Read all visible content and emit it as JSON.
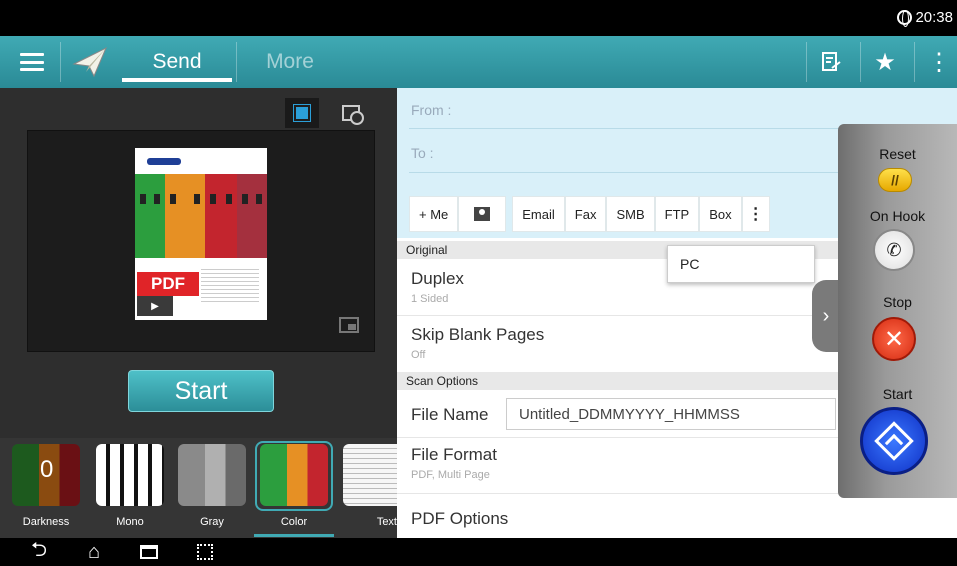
{
  "status_bar": {
    "time": "20:38",
    "icons": [
      "globe-icon"
    ]
  },
  "action_bar": {
    "menu_icon": "hamburger-icon",
    "app_icon": "paper-plane-icon",
    "tabs": [
      {
        "label": "Send",
        "selected": true
      },
      {
        "label": "More",
        "selected": false
      }
    ],
    "right_icons": [
      "edit-document-icon",
      "star-icon",
      "overflow-menu-icon"
    ]
  },
  "preview": {
    "view_modes": [
      "preview-image-icon",
      "preview-settings-icon"
    ],
    "pdf_badge": "PDF",
    "start_label": "Start"
  },
  "color_modes": [
    {
      "label": "Darkness",
      "value": "0"
    },
    {
      "label": "Mono"
    },
    {
      "label": "Gray"
    },
    {
      "label": "Color",
      "selected": true
    },
    {
      "label": "Text"
    }
  ],
  "address": {
    "from_label": "From :",
    "to_label": "To :"
  },
  "destination_buttons": [
    "+ Me",
    "Email",
    "Fax",
    "SMB",
    "FTP",
    "Box"
  ],
  "more_popup": {
    "option": "PC"
  },
  "sections": {
    "original": "Original",
    "scan_options": "Scan Options"
  },
  "settings": {
    "duplex": {
      "title": "Duplex",
      "value": "1 Sided"
    },
    "skip_blank": {
      "title": "Skip Blank Pages",
      "value": "Off"
    },
    "file_name": {
      "title": "File Name",
      "value": "Untitled_DDMMYYYY_HHMMSS"
    },
    "file_format": {
      "title": "File Format",
      "value": "PDF, Multi Page"
    },
    "pdf_options": {
      "title": "PDF Options"
    }
  },
  "control_panel": {
    "reset": "Reset",
    "on_hook": "On Hook",
    "stop": "Stop",
    "start": "Start"
  },
  "nav_bar": [
    "back-icon",
    "home-icon",
    "recent-apps-icon",
    "screen-capture-icon"
  ],
  "colors": {
    "accent": "#40aab4",
    "address_bg": "#d9f0f9",
    "stop": "#d42a10",
    "start": "#0e2fc4",
    "reset": "#ffe04a"
  }
}
